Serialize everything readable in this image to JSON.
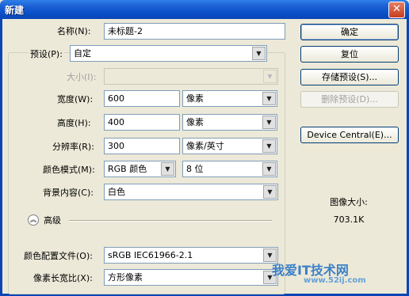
{
  "window": {
    "title": "新建",
    "close_glyph": "✕"
  },
  "form": {
    "name_label": "名称(N):",
    "name_value": "未标题-2",
    "preset_label": "预设(P):",
    "preset_value": "自定",
    "size_label": "大小(I):",
    "size_value": "",
    "width_label": "宽度(W):",
    "width_value": "600",
    "width_unit": "像素",
    "height_label": "高度(H):",
    "height_value": "400",
    "height_unit": "像素",
    "resolution_label": "分辨率(R):",
    "resolution_value": "300",
    "resolution_unit": "像素/英寸",
    "color_mode_label": "颜色模式(M):",
    "color_mode_value": "RGB 颜色",
    "bit_depth_value": "8 位",
    "background_label": "背景内容(C):",
    "background_value": "白色",
    "advanced_label": "高级",
    "advanced_icon": "chevron-up-double-icon",
    "color_profile_label": "颜色配置文件(O):",
    "color_profile_value": "sRGB IEC61966-2.1",
    "pixel_aspect_label": "像素长宽比(X):",
    "pixel_aspect_value": "方形像素"
  },
  "buttons": {
    "ok": "确定",
    "reset": "复位",
    "save_preset": "存储预设(S)...",
    "delete_preset": "删除预设(D)...",
    "device_central": "Device Central(E)..."
  },
  "info": {
    "image_size_label": "图像大小:",
    "image_size_value": "703.1K"
  },
  "watermark": {
    "text": "我爱IT技术网",
    "url": "www.52ij.com"
  },
  "colors": {
    "titlebar": "#0a4fc7",
    "dialog_bg": "#ece9d8",
    "field_border": "#7f9db9"
  }
}
